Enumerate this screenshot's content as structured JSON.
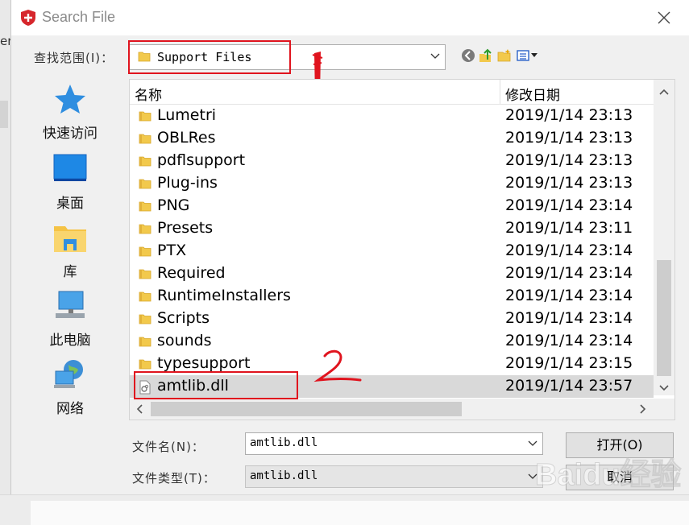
{
  "window": {
    "title": "Search File"
  },
  "background_text": "er",
  "lookin": {
    "label": "查找范围(I)：",
    "value": "Support Files"
  },
  "places": [
    {
      "label": "快速访问",
      "icon": "quick-access-star-icon"
    },
    {
      "label": "桌面",
      "icon": "desktop-icon"
    },
    {
      "label": "库",
      "icon": "library-icon"
    },
    {
      "label": "此电脑",
      "icon": "this-pc-icon"
    },
    {
      "label": "网络",
      "icon": "network-icon"
    }
  ],
  "list": {
    "columns": [
      "名称",
      "修改日期"
    ],
    "rows": [
      {
        "name": "Lumetri",
        "date": "2019/1/14 23:13",
        "type": "folder"
      },
      {
        "name": "OBLRes",
        "date": "2019/1/14 23:13",
        "type": "folder"
      },
      {
        "name": "pdflsupport",
        "date": "2019/1/14 23:13",
        "type": "folder"
      },
      {
        "name": "Plug-ins",
        "date": "2019/1/14 23:13",
        "type": "folder"
      },
      {
        "name": "PNG",
        "date": "2019/1/14 23:14",
        "type": "folder"
      },
      {
        "name": "Presets",
        "date": "2019/1/14 23:11",
        "type": "folder"
      },
      {
        "name": "PTX",
        "date": "2019/1/14 23:14",
        "type": "folder"
      },
      {
        "name": "Required",
        "date": "2019/1/14 23:14",
        "type": "folder"
      },
      {
        "name": "RuntimeInstallers",
        "date": "2019/1/14 23:14",
        "type": "folder"
      },
      {
        "name": "Scripts",
        "date": "2019/1/14 23:14",
        "type": "folder"
      },
      {
        "name": "sounds",
        "date": "2019/1/14 23:14",
        "type": "folder"
      },
      {
        "name": "typesupport",
        "date": "2019/1/14 23:15",
        "type": "folder"
      },
      {
        "name": "amtlib.dll",
        "date": "2019/1/14 23:57",
        "type": "dll",
        "selected": true
      }
    ]
  },
  "filename": {
    "label": "文件名(N)：",
    "value": "amtlib.dll"
  },
  "filetype": {
    "label": "文件类型(T)：",
    "value": "amtlib.dll"
  },
  "buttons": {
    "open": "打开(O)",
    "cancel": "取消"
  },
  "annotations": {
    "mark2": "2"
  },
  "watermark": {
    "text": "Baidu经验",
    "url": "jingyan.baidu.com"
  },
  "colors": {
    "annotation_red": "#e0141e",
    "selection": "#d9d9d9",
    "folder": "#f2c94c"
  }
}
